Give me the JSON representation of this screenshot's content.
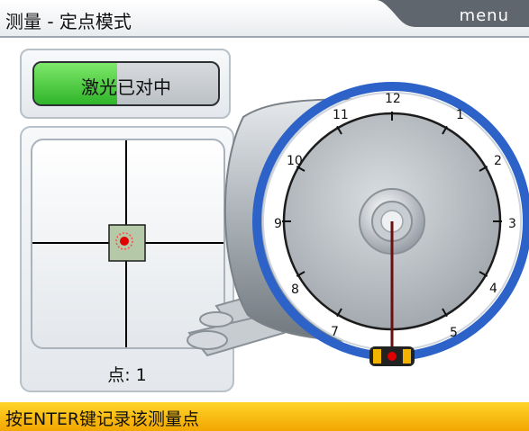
{
  "header": {
    "title": "测量 - 定点模式",
    "menu_label": "menu"
  },
  "status": {
    "label": "激光已对中",
    "progress": 0.45,
    "fill_color": "#2fb52a"
  },
  "target": {
    "point_label": "点: 1",
    "marker_color": "#e00000"
  },
  "clock": {
    "labels": [
      "12",
      "1",
      "2",
      "3",
      "4",
      "5",
      "7",
      "8",
      "9",
      "10",
      "11"
    ]
  },
  "footer": {
    "instruction": "按ENTER键记录该测量点"
  },
  "colors": {
    "header_tab": "#5f666e",
    "ring_blue": "#2d63c8",
    "footer_yellow": "#f5b400"
  }
}
